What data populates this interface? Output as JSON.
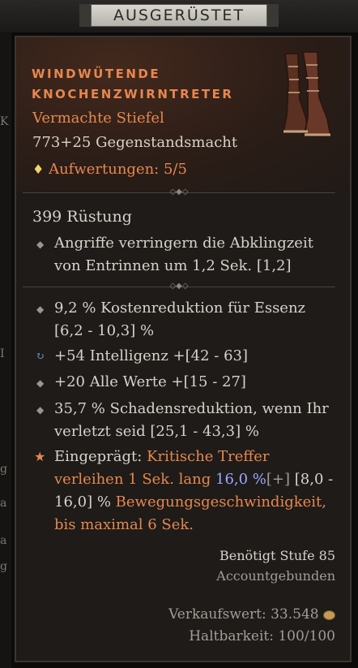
{
  "header": {
    "title": "AUSGERÜSTET"
  },
  "item": {
    "name_line1": "WINDWÜTENDE",
    "name_line2": "KNOCHENZWIRNTRETER",
    "type": "Vermachte Stiefel",
    "item_power": "773+25 Gegenstandsmacht",
    "upgrades": "Aufwertungen: 5/5",
    "armor": "399 Rüstung",
    "implicit_line1": "Angriffe verringern die Abklingzeit",
    "implicit_line2": "von Entrinnen um 1,2 Sek. [1,2]"
  },
  "affixes": [
    {
      "line1": "9,2 % Kostenreduktion für Essenz",
      "line2": "[6,2 - 10,3] %"
    },
    {
      "line1": "+54 Intelligenz +[42 - 63]"
    },
    {
      "line1": "+20 Alle Werte +[15 - 27]"
    },
    {
      "line1": "35,7 % Schadensreduktion, wenn Ihr",
      "line2": "verletzt seid [25,1 - 43,3] %"
    }
  ],
  "aspect": {
    "label": "Eingeprägt:",
    "l1_text": "Kritische Treffer",
    "l2_text": "verleihen 1 Sek. lang",
    "l2_value": "16,0 %",
    "l2_plus": "[+]",
    "l2_range": "[8,0 -",
    "l3_range": "16,0] %",
    "l3_text": "Bewegungsgeschwindigkeit,",
    "l4_text": "bis maximal 6 Sek."
  },
  "requirements": {
    "level": "Benötigt Stufe 85",
    "bound": "Accountgebunden"
  },
  "footer": {
    "sell_value": "Verkaufswert: 33.548",
    "durability": "Haltbarkeit: 100/100"
  },
  "left_strip_glyphs": [
    "K",
    "I",
    "g",
    "a",
    "a",
    "g"
  ],
  "icons": {
    "upgrade": "diamond-spark-icon",
    "gold": "gold-coin-icon",
    "affix_bullet": "diamond-bullet-icon",
    "intelligence_bullet": "reroll-circle-icon",
    "aspect_bullet": "star-icon"
  },
  "colors": {
    "legendary_orange": "#e7874f",
    "value_blue": "#9da8ff",
    "text": "#d8d2c8"
  }
}
